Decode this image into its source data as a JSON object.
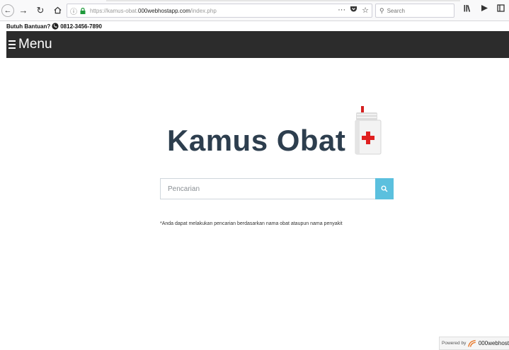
{
  "browser": {
    "url_prefix": "https://kamus-obat.",
    "url_domain": "000webhostapp.com",
    "url_path": "/index.php",
    "search_placeholder": "Search",
    "more_label": "···"
  },
  "help": {
    "label": "Butuh Bantuan?",
    "phone": "0812-3456-7890"
  },
  "menu": {
    "label": "Menu"
  },
  "main": {
    "logo_text": "Kamus Obat",
    "search_placeholder": "Pencarian",
    "note": "*Anda dapat melakukan pencarian berdasarkan nama obat ataupun nama penyakit"
  },
  "footer": {
    "powered_label": "Powered by",
    "powered_brand": "000webhost"
  },
  "colors": {
    "menu_bg": "#2c2c2c",
    "logo_text": "#2d3e4e",
    "search_button": "#5bc0de",
    "cross_red": "#e02020"
  },
  "icons": [
    "back-icon",
    "forward-icon",
    "reload-icon",
    "home-icon",
    "info-icon",
    "lock-icon",
    "pocket-icon",
    "bookmark-star-icon",
    "search-icon",
    "library-icon",
    "sidebar-icon",
    "reader-icon",
    "phone-icon",
    "hamburger-icon",
    "medicine-book-icon"
  ]
}
